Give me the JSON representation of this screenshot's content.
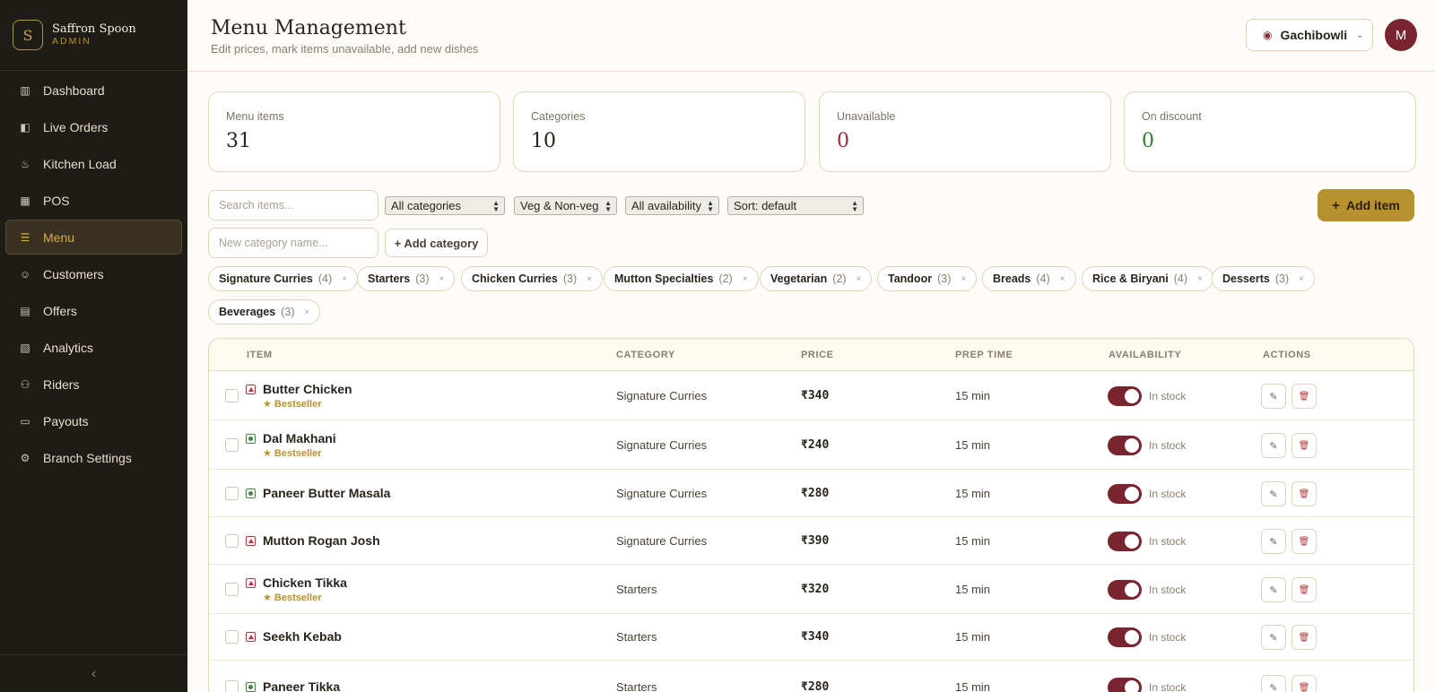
{
  "brand": {
    "logo": "S",
    "name": "Saffron Spoon",
    "sub": "ADMIN"
  },
  "nav": [
    {
      "label": "Dashboard",
      "icon": "bar-chart-icon",
      "glyph": "▥",
      "active": false
    },
    {
      "label": "Live Orders",
      "icon": "bag-icon",
      "glyph": "◧",
      "active": false
    },
    {
      "label": "Kitchen Load",
      "icon": "flame-icon",
      "glyph": "♨",
      "active": false
    },
    {
      "label": "POS",
      "icon": "grid-icon",
      "glyph": "▦",
      "active": false
    },
    {
      "label": "Menu",
      "icon": "list-icon",
      "glyph": "☰",
      "active": true
    },
    {
      "label": "Customers",
      "icon": "user-icon",
      "glyph": "☺",
      "active": false
    },
    {
      "label": "Offers",
      "icon": "ticket-icon",
      "glyph": "▤",
      "active": false
    },
    {
      "label": "Analytics",
      "icon": "analytics-icon",
      "glyph": "▧",
      "active": false
    },
    {
      "label": "Riders",
      "icon": "bike-icon",
      "glyph": "⚇",
      "active": false
    },
    {
      "label": "Payouts",
      "icon": "wallet-icon",
      "glyph": "▭",
      "active": false
    },
    {
      "label": "Branch Settings",
      "icon": "gear-icon",
      "glyph": "⚙",
      "active": false
    }
  ],
  "collapse_glyph": "‹",
  "header": {
    "title": "Menu Management",
    "subtitle": "Edit prices, mark items unavailable, add new dishes",
    "branch": "Gachibowli",
    "avatar": "M"
  },
  "stats": [
    {
      "label": "Menu items",
      "value": "31",
      "tone": ""
    },
    {
      "label": "Categories",
      "value": "10",
      "tone": ""
    },
    {
      "label": "Unavailable",
      "value": "0",
      "tone": "red"
    },
    {
      "label": "On discount",
      "value": "0",
      "tone": "green"
    }
  ],
  "filters": {
    "search_placeholder": "Search items...",
    "category": "All categories",
    "diet": "Veg & Non-veg",
    "availability": "All availability",
    "sort": "Sort: default",
    "add_item": "Add item",
    "new_category_placeholder": "New category name...",
    "add_category": "+ Add category"
  },
  "chips": [
    {
      "name": "Signature Curries",
      "count": "(4)"
    },
    {
      "name": "Starters",
      "count": "(3)"
    },
    {
      "name": "Chicken Curries",
      "count": "(3)"
    },
    {
      "name": "Mutton Specialties",
      "count": "(2)"
    },
    {
      "name": "Vegetarian",
      "count": "(2)"
    },
    {
      "name": "Tandoor",
      "count": "(3)"
    },
    {
      "name": "Breads",
      "count": "(4)"
    },
    {
      "name": "Rice & Biryani",
      "count": "(4)"
    },
    {
      "name": "Desserts",
      "count": "(3)"
    },
    {
      "name": "Beverages",
      "count": "(3)"
    }
  ],
  "table": {
    "columns": [
      "ITEM",
      "CATEGORY",
      "PRICE",
      "PREP TIME",
      "AVAILABILITY",
      "ACTIONS"
    ],
    "rows": [
      {
        "name": "Butter Chicken",
        "badge": "★ Bestseller",
        "diet": "nonveg",
        "category": "Signature Curries",
        "price": "₹340",
        "prep": "15 min",
        "availability": "In stock"
      },
      {
        "name": "Dal Makhani",
        "badge": "★ Bestseller",
        "diet": "veg",
        "category": "Signature Curries",
        "price": "₹240",
        "prep": "15 min",
        "availability": "In stock"
      },
      {
        "name": "Paneer Butter Masala",
        "badge": "",
        "diet": "veg",
        "category": "Signature Curries",
        "price": "₹280",
        "prep": "15 min",
        "availability": "In stock"
      },
      {
        "name": "Mutton Rogan Josh",
        "badge": "",
        "diet": "nonveg",
        "category": "Signature Curries",
        "price": "₹390",
        "prep": "15 min",
        "availability": "In stock"
      },
      {
        "name": "Chicken Tikka",
        "badge": "★ Bestseller",
        "diet": "nonveg",
        "category": "Starters",
        "price": "₹320",
        "prep": "15 min",
        "availability": "In stock"
      },
      {
        "name": "Seekh Kebab",
        "badge": "",
        "diet": "nonveg",
        "category": "Starters",
        "price": "₹340",
        "prep": "15 min",
        "availability": "In stock"
      },
      {
        "name": "Paneer Tikka",
        "badge": "",
        "diet": "veg",
        "category": "Starters",
        "price": "₹280",
        "prep": "15 min",
        "availability": "In stock"
      }
    ]
  }
}
